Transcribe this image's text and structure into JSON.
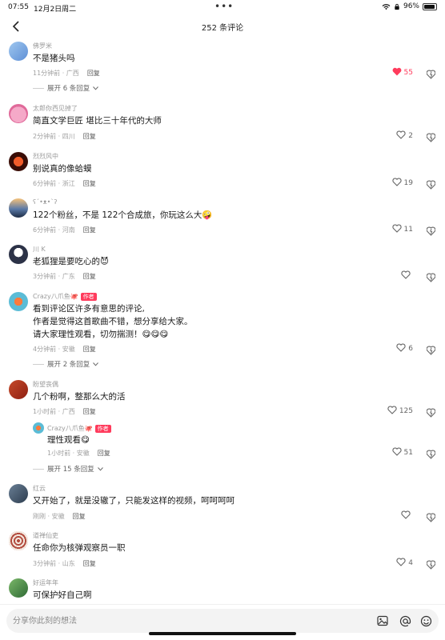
{
  "status_bar": {
    "time": "07:55",
    "date": "12月2日周二",
    "battery": "96%",
    "battery_level": 0.96
  },
  "header": {
    "title": "252 条评论"
  },
  "comments": [
    {
      "user": "佛罗米",
      "text": [
        "不是猪头吗"
      ],
      "meta": "11分钟前 · 广西",
      "reply": "回复",
      "likes": "55",
      "liked": true,
      "expand": "展开 6 条回复"
    },
    {
      "user": "太郎你西见掉了",
      "text": [
        "简直文学巨匠 堪比三十年代的大师"
      ],
      "meta": "2分钟前 · 四川",
      "reply": "回复",
      "likes": "2"
    },
    {
      "user": "烈烈风中",
      "text": [
        "别说真的像蛤蟆"
      ],
      "meta": "6分钟前 · 浙江",
      "reply": "回复",
      "likes": "19"
    },
    {
      "user": "ʕ´•ᴥ•`ʔ",
      "text": [
        "122个粉丝，不是 122个合成旅，你玩这么大🤪"
      ],
      "meta": "6分钟前 · 河南",
      "reply": "回复",
      "likes": "11"
    },
    {
      "user": "川 K",
      "text": [
        "老狐狸是要吃心的😈"
      ],
      "meta": "3分钟前 · 广东",
      "reply": "回复",
      "likes": ""
    },
    {
      "user": "Crazy八爪鱼🐙",
      "badge": "作者",
      "text": [
        "看到评论区许多有意思的评论,",
        "作者是觉得这首歌曲不错，想分享给大家。",
        "请大家理性观看，切勿揣测！😋😋😋"
      ],
      "meta": "4分钟前 · 安徽",
      "reply": "回复",
      "likes": "6",
      "expand": "展开 2 条回复"
    },
    {
      "user": "盼望丧偶",
      "text": [
        "几个粉啊，整那么大的活"
      ],
      "meta": "1小时前 · 广西",
      "reply": "回复",
      "likes": "125",
      "sub_reply": {
        "user": "Crazy八爪鱼🐙",
        "badge": "作者",
        "text": "理性观看😋",
        "meta": "1小时前 · 安徽",
        "reply": "回复",
        "likes": "51"
      },
      "expand": "展开 15 条回复"
    },
    {
      "user": "红云",
      "text": [
        "又开始了，就是没辙了，只能发这样的视频，呵呵呵呵"
      ],
      "meta": "刚刚 · 安徽",
      "reply": "回复",
      "likes": ""
    },
    {
      "user": "道禅仙吏",
      "text": [
        "任命你为核弹观察员一职"
      ],
      "meta": "3分钟前 · 山东",
      "reply": "回复",
      "likes": "4"
    },
    {
      "user": "好运年年",
      "text": [
        "可保护好自己啊"
      ]
    }
  ],
  "input": {
    "placeholder": "分享你此刻的想法"
  },
  "icons": {
    "back": "chevron-left-icon",
    "heart": "heart-icon",
    "dislike": "dislike-icon",
    "chevron": "chevron-down-icon",
    "image": "image-icon",
    "at": "at-icon",
    "emoji": "emoji-icon"
  },
  "colors": {
    "liked": "#ff3b5c",
    "author_badge": "#ff3b5c",
    "meta": "#a0a0a0"
  }
}
